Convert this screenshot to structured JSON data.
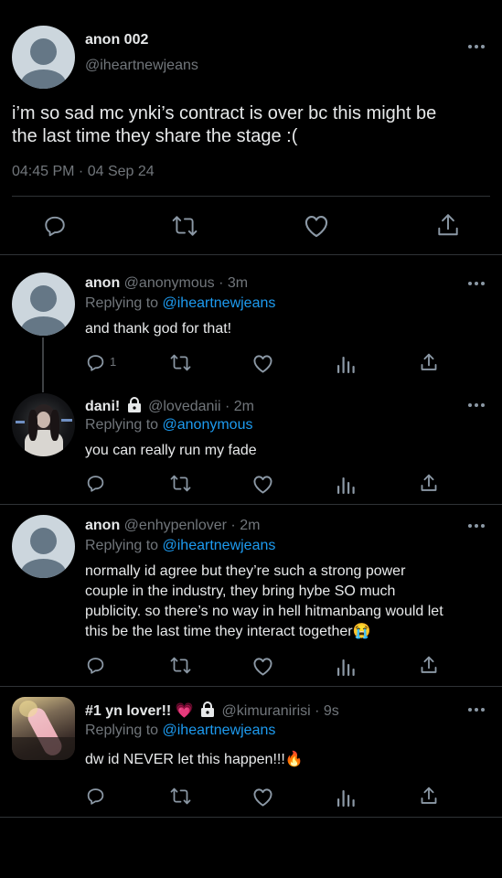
{
  "main_tweet": {
    "display_name": "anon 002",
    "handle": "@iheartnewjeans",
    "text_line1": "i’m so sad mc ynki’s contract is over bc this might be",
    "text_line2": "the last time they share the stage :(",
    "timestamp": "04:45 PM · 04 Sep 24"
  },
  "replies": [
    {
      "display_name": "anon",
      "handle_time": "@anonymous · 3m",
      "replying_prefix": "Replying to",
      "replying_to": "@iheartnewjeans",
      "text": "and thank god for that!",
      "reply_count": "1"
    },
    {
      "display_name": "dani!",
      "handle_time": "@lovedanii · 2m",
      "replying_prefix": "Replying to",
      "replying_to": "@anonymous",
      "text": "you can really run my fade"
    },
    {
      "display_name": "anon",
      "handle_time": "@enhypenlover · 2m",
      "replying_prefix": "Replying to",
      "replying_to": "@iheartnewjeans",
      "text_lines": [
        "normally id agree but they’re such a strong power",
        "couple in the industry, they bring hybe SO much",
        "publicity. so there’s no way in hell hitmanbang would let",
        "this be the last time they interact together😭"
      ]
    },
    {
      "display_name": "#1 yn lover!! 💗",
      "handle_time": "@kimuranirisi · 9s",
      "replying_prefix": "Replying to",
      "replying_to": "@iheartnewjeans",
      "text": "dw id NEVER let this happen!!!🔥"
    }
  ],
  "colors": {
    "background": "#000000",
    "text": "#e7e9ea",
    "secondary": "#71767b",
    "accent": "#1d9bf0",
    "divider": "#2f3336"
  },
  "icons": [
    "reply-icon",
    "retweet-icon",
    "like-icon",
    "views-icon",
    "share-icon",
    "lock-icon",
    "more-icon"
  ]
}
